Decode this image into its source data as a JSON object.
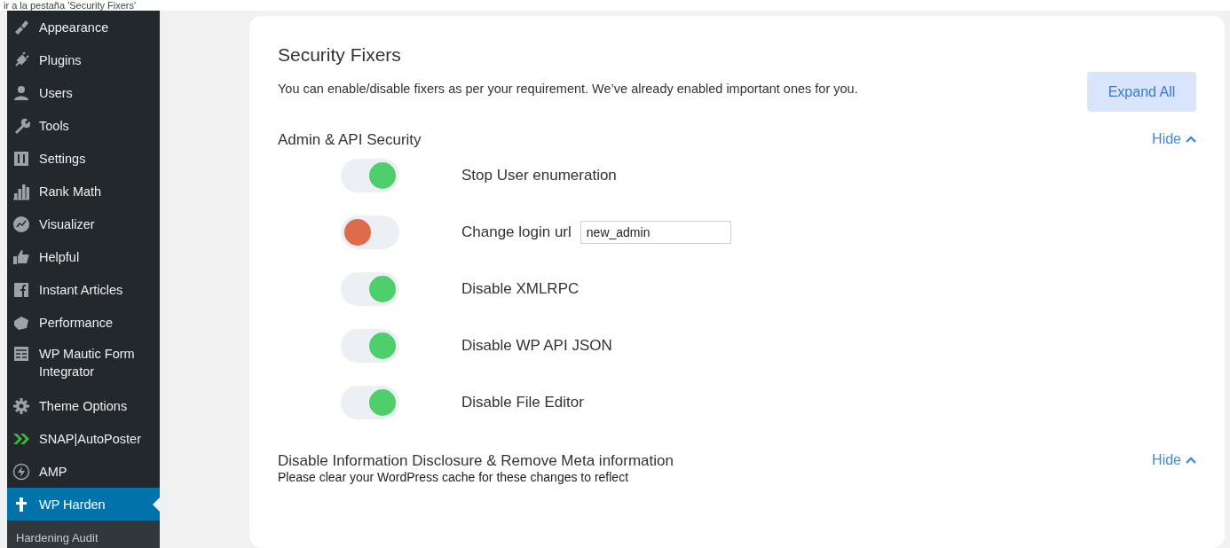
{
  "caption": "ir a la pestaña 'Security Fixers'",
  "sidebar": {
    "items": [
      {
        "label": "Appearance",
        "selected": false
      },
      {
        "label": "Plugins",
        "selected": false
      },
      {
        "label": "Users",
        "selected": false
      },
      {
        "label": "Tools",
        "selected": false
      },
      {
        "label": "Settings",
        "selected": false
      },
      {
        "label": "Rank Math",
        "selected": false
      },
      {
        "label": "Visualizer",
        "selected": false
      },
      {
        "label": "Helpful",
        "selected": false
      },
      {
        "label": "Instant Articles",
        "selected": false
      },
      {
        "label": "Performance",
        "selected": false
      },
      {
        "label": "WP Mautic Form Integrator",
        "selected": false
      },
      {
        "label": "Theme Options",
        "selected": false
      },
      {
        "label": "SNAP|AutoPoster",
        "selected": false
      },
      {
        "label": "AMP",
        "selected": false
      },
      {
        "label": "WP Harden",
        "selected": true
      }
    ],
    "submenu": [
      {
        "label": "Hardening Audit",
        "selected": false
      }
    ]
  },
  "panel": {
    "title": "Security Fixers",
    "description": "You can enable/disable fixers as per your requirement. We’ve already enabled important ones for you.",
    "expand_button": "Expand All",
    "sections": [
      {
        "title": "Admin & API Security",
        "toggle_label": "Hide",
        "expanded": true,
        "fixers": [
          {
            "label": "Stop User enumeration",
            "on": true
          },
          {
            "label": "Change login url",
            "on": false,
            "input_value": "new_admin"
          },
          {
            "label": "Disable XMLRPC",
            "on": true
          },
          {
            "label": "Disable WP API JSON",
            "on": true
          },
          {
            "label": "Disable File Editor",
            "on": true
          }
        ]
      },
      {
        "title": "Disable Information Disclosure & Remove Meta information",
        "note": "Please clear your WordPress cache for these changes to reflect",
        "toggle_label": "Hide",
        "expanded": true
      }
    ]
  }
}
